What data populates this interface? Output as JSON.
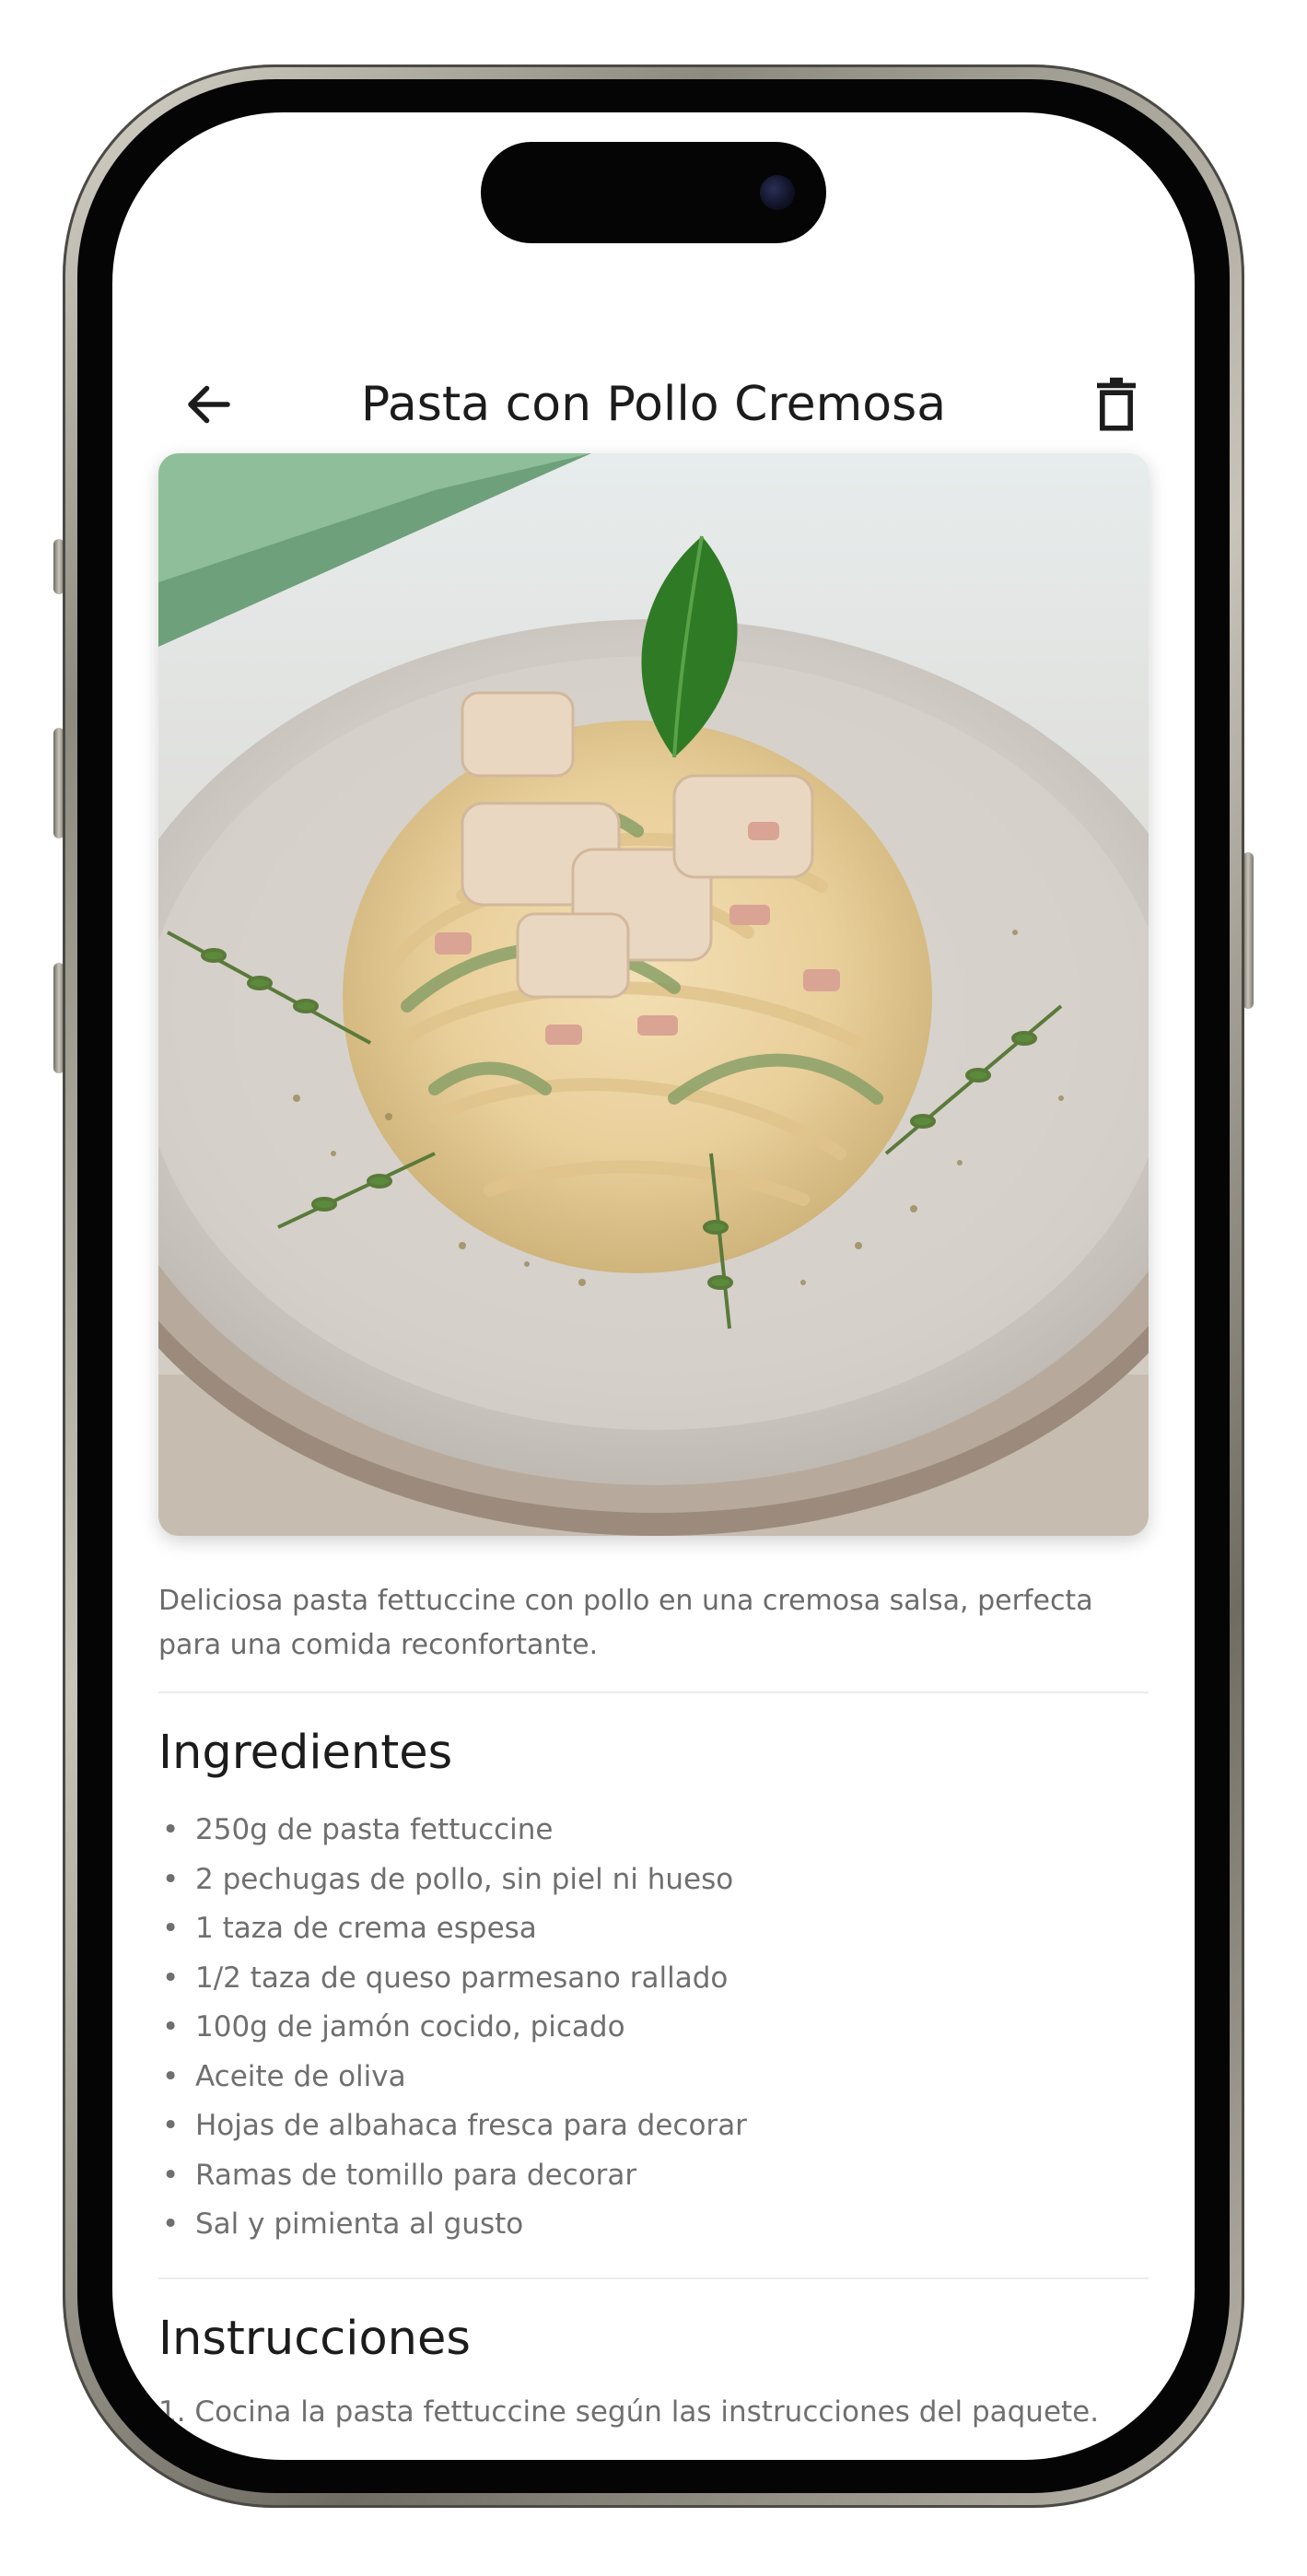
{
  "header": {
    "title": "Pasta con Pollo Cremosa",
    "back_icon": "arrow-left-icon",
    "delete_icon": "trash-icon"
  },
  "recipe": {
    "description": "Deliciosa pasta fettuccine con pollo en una cremosa salsa, perfecta para una comida reconfortante.",
    "ingredients_title": "Ingredientes",
    "ingredients": [
      "250g de pasta fettuccine",
      "2 pechugas de pollo, sin piel ni hueso",
      "1 taza de crema espesa",
      "1/2 taza de queso parmesano rallado",
      "100g de jamón cocido, picado",
      "Aceite de oliva",
      "Hojas de albahaca fresca para decorar",
      "Ramas de tomillo para decorar",
      "Sal y pimienta al gusto"
    ],
    "bullet": "•",
    "instructions_title": "Instrucciones",
    "instructions": [
      "1. Cocina la pasta fettuccine según las instrucciones del paquete."
    ]
  },
  "colors": {
    "title_text": "#1c1c1c",
    "body_text": "#6b6b6b",
    "divider": "#ececec",
    "background": "#ffffff"
  }
}
